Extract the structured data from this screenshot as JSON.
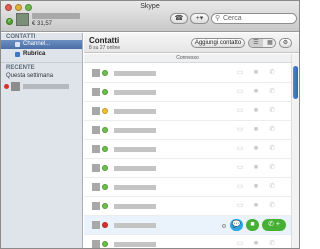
{
  "window": {
    "title": "Skype"
  },
  "profile": {
    "credit": "€ 31,57",
    "status_icon": "checkmark"
  },
  "toolbar": {
    "phone_glyph": "☎",
    "add_glyph": "+▾",
    "search_placeholder": "Cerca"
  },
  "sidebar": {
    "contacts_heading": "CONTATTI",
    "items": [
      {
        "label": "Channel..."
      },
      {
        "label": "Rubrica"
      }
    ],
    "recent_heading": "RECENTE",
    "week_label": "Questa settimana"
  },
  "main": {
    "title": "Contatti",
    "subtitle": "8 su 27 online",
    "add_contact": "Aggiungi contatto",
    "group_header": "Connesso"
  },
  "colors": {
    "online": "#6cc04a",
    "away": "#f2c12e",
    "busy": "#d9322b",
    "chat": "#2ea3e0",
    "call": "#46b035"
  },
  "contacts": [
    {
      "status": "online"
    },
    {
      "status": "online"
    },
    {
      "status": "away"
    },
    {
      "status": "online"
    },
    {
      "status": "online"
    },
    {
      "status": "online"
    },
    {
      "status": "online"
    },
    {
      "status": "online"
    },
    {
      "status": "busy"
    },
    {
      "status": "online"
    }
  ]
}
